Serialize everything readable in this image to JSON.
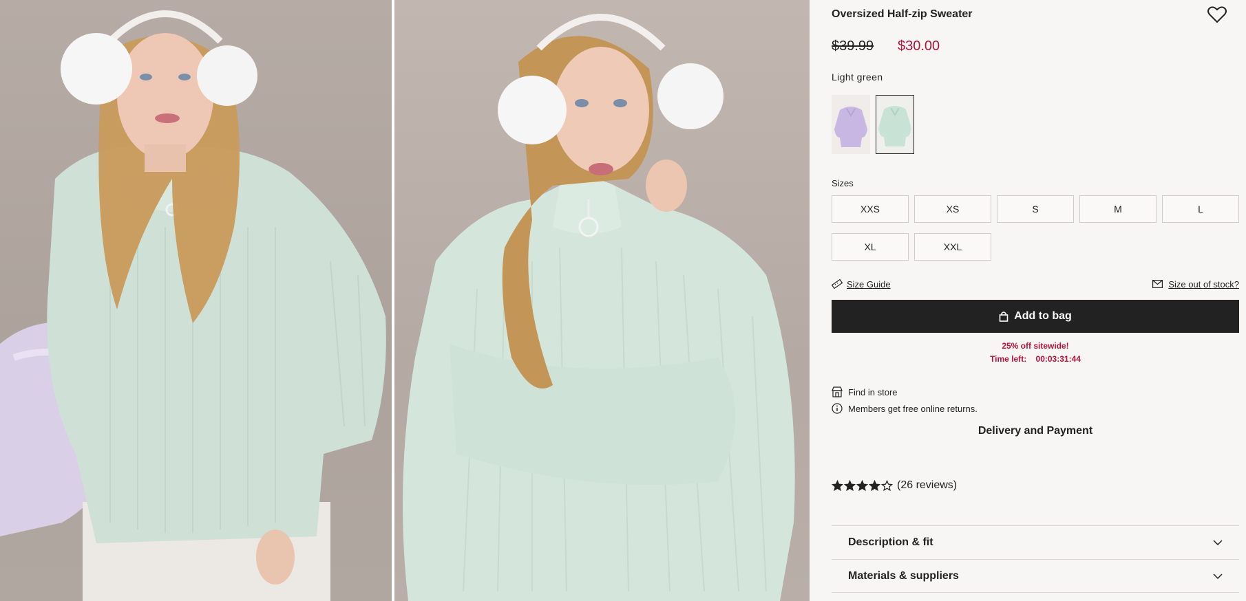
{
  "product": {
    "title": "Oversized Half-zip Sweater",
    "price_original": "$39.99",
    "price_sale": "$30.00",
    "sale_color": "#b5123a",
    "color_name": "Light green",
    "swatches": [
      {
        "name": "Lilac",
        "selected": false
      },
      {
        "name": "Light green",
        "selected": true
      }
    ]
  },
  "sizes": {
    "label": "Sizes",
    "options": [
      "XXS",
      "XS",
      "S",
      "M",
      "L",
      "XL",
      "XXL"
    ]
  },
  "links": {
    "size_guide": "Size Guide",
    "size_out_of_stock": "Size out of stock?"
  },
  "cart": {
    "add_label": "Add to bag"
  },
  "promo": {
    "headline": "25% off sitewide!",
    "time_left_label": "Time left:",
    "countdown": "00:03:31:44"
  },
  "info": {
    "find_in_store": "Find in store",
    "free_returns": "Members get free online returns.",
    "delivery_heading": "Delivery and Payment"
  },
  "rating": {
    "stars": 4,
    "max_stars": 5,
    "reviews_text": "(26 reviews)"
  },
  "accordions": [
    "Description & fit",
    "Materials & suppliers"
  ],
  "icons": [
    "heart-icon",
    "ruler-icon",
    "mail-icon",
    "bag-lock-icon",
    "store-icon",
    "info-icon",
    "star-icon",
    "chevron-down-icon"
  ]
}
